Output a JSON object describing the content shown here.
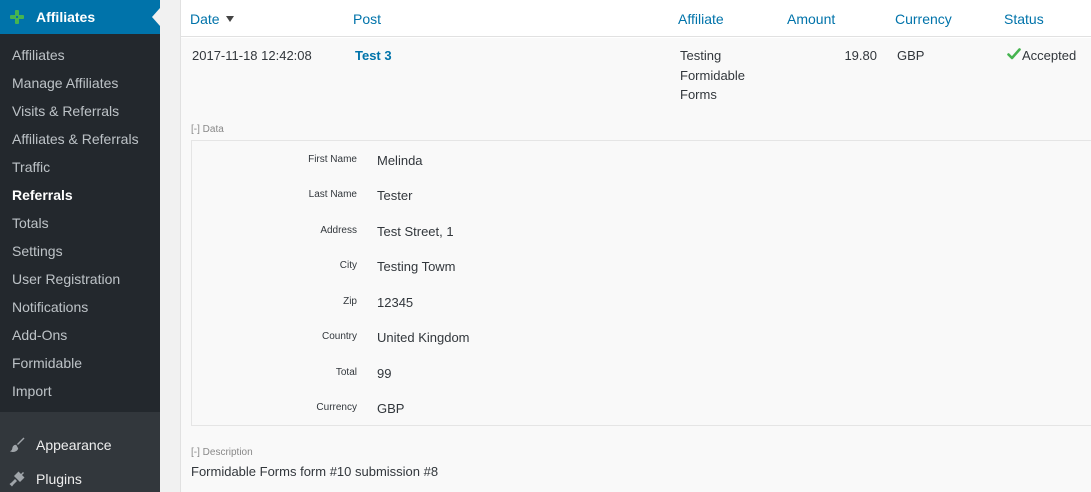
{
  "sidebar": {
    "current_menu": {
      "label": "Affiliates",
      "icon": "affiliates-icon"
    },
    "submenu": [
      {
        "label": "Affiliates",
        "active": false
      },
      {
        "label": "Manage Affiliates",
        "active": false
      },
      {
        "label": "Visits & Referrals",
        "active": false
      },
      {
        "label": "Affiliates & Referrals",
        "active": false
      },
      {
        "label": "Traffic",
        "active": false
      },
      {
        "label": "Referrals",
        "active": true
      },
      {
        "label": "Totals",
        "active": false
      },
      {
        "label": "Settings",
        "active": false
      },
      {
        "label": "User Registration",
        "active": false
      },
      {
        "label": "Notifications",
        "active": false
      },
      {
        "label": "Add-Ons",
        "active": false
      },
      {
        "label": "Formidable",
        "active": false
      },
      {
        "label": "Import",
        "active": false
      }
    ],
    "lower_menu": [
      {
        "label": "Appearance",
        "icon": "paintbrush-icon"
      },
      {
        "label": "Plugins",
        "icon": "plugin-icon"
      }
    ]
  },
  "table": {
    "headers": {
      "date": "Date",
      "post": "Post",
      "affiliate": "Affiliate",
      "amount": "Amount",
      "currency": "Currency",
      "status": "Status"
    },
    "row": {
      "date": "2017-11-18 12:42:08",
      "post": "Test 3",
      "affiliate_lines": [
        "Testing",
        "Formidable",
        "Forms"
      ],
      "amount": "19.80",
      "currency": "GBP",
      "status": "Accepted"
    }
  },
  "data_section": {
    "toggle_label": "[-] Data",
    "fields": [
      {
        "label": "First Name",
        "value": "Melinda"
      },
      {
        "label": "Last Name",
        "value": "Tester"
      },
      {
        "label": "Address",
        "value": "Test Street, 1"
      },
      {
        "label": "City",
        "value": "Testing Towm"
      },
      {
        "label": "Zip",
        "value": "12345"
      },
      {
        "label": "Country",
        "value": "United Kingdom"
      },
      {
        "label": "Total",
        "value": "99"
      },
      {
        "label": "Currency",
        "value": "GBP"
      }
    ]
  },
  "description_section": {
    "toggle_label": "[-] Description",
    "text": "Formidable Forms form #10 submission #8"
  },
  "colors": {
    "sidebar_bg": "#32373c",
    "submenu_bg": "#23282d",
    "accent": "#0073aa",
    "accepted_check": "#46b450"
  }
}
